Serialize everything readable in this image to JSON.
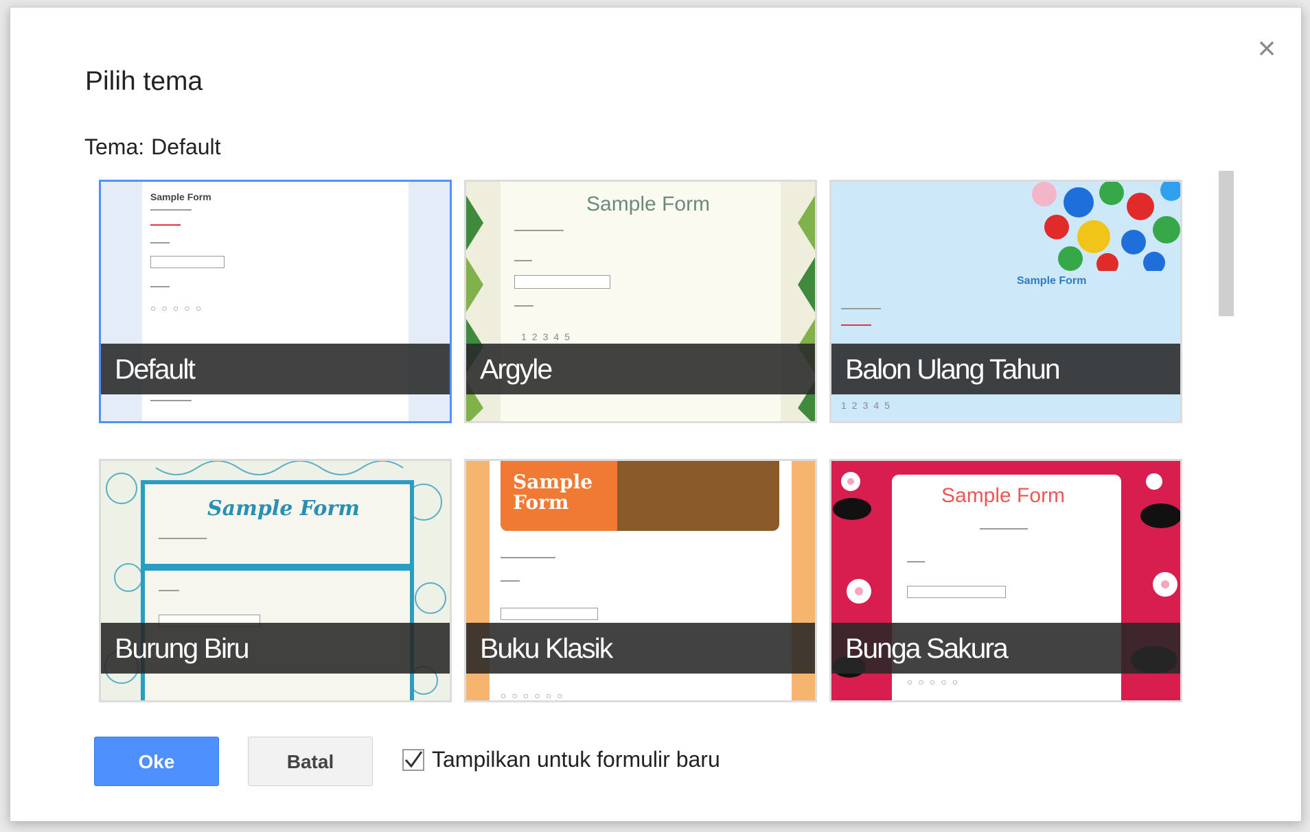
{
  "dialog": {
    "title": "Pilih tema",
    "current_label": "Tema:",
    "current_value": "Default",
    "close_icon": "close-icon"
  },
  "themes": [
    {
      "name": "Default",
      "selected": true,
      "preview_title": "Sample Form"
    },
    {
      "name": "Argyle",
      "selected": false,
      "preview_title": "Sample Form"
    },
    {
      "name": "Balon Ulang Tahun",
      "selected": false,
      "preview_title": "Sample Form"
    },
    {
      "name": "Burung Biru",
      "selected": false,
      "preview_title": "Sample Form"
    },
    {
      "name": "Buku Klasik",
      "selected": false,
      "preview_title": "Sample Form"
    },
    {
      "name": "Bunga Sakura",
      "selected": false,
      "preview_title": "Sample Form"
    }
  ],
  "footer": {
    "ok_label": "Oke",
    "cancel_label": "Batal",
    "checkbox_label": "Tampilkan untuk formulir baru",
    "checkbox_checked": true
  },
  "colors": {
    "accent": "#4d90fe",
    "label_bar": "#282828"
  }
}
